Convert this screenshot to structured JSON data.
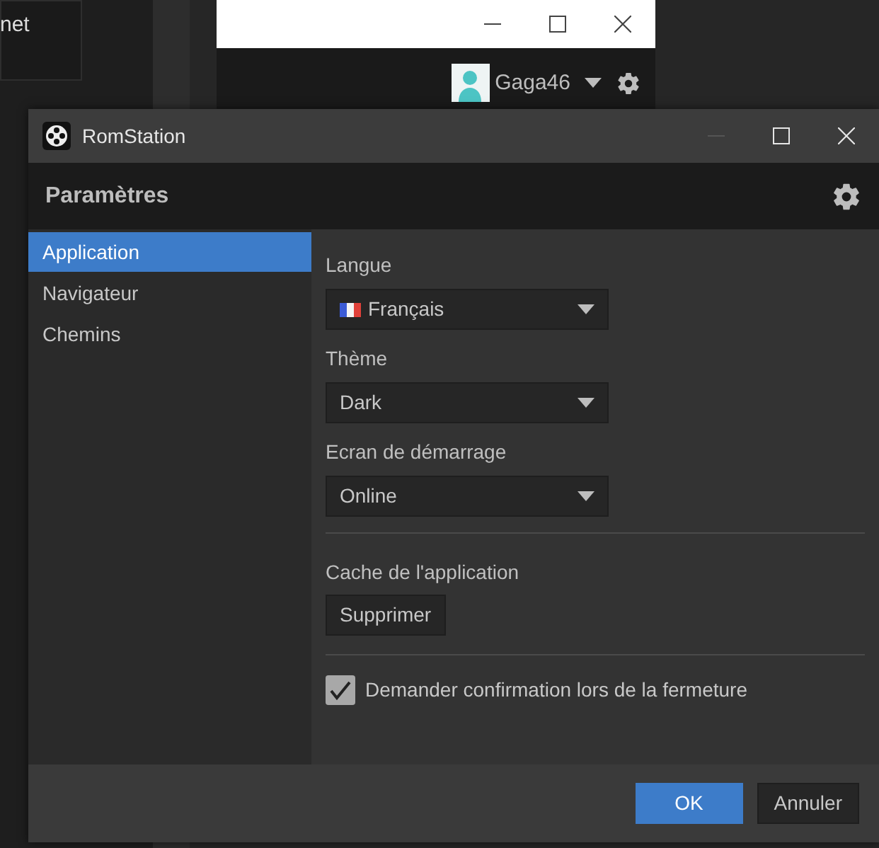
{
  "background_window": {
    "partial_text": "net",
    "user": {
      "name": "Gaga46"
    }
  },
  "window": {
    "title": "RomStation"
  },
  "header": {
    "title": "Paramètres"
  },
  "sidebar": {
    "items": [
      {
        "label": "Application",
        "selected": true
      },
      {
        "label": "Navigateur",
        "selected": false
      },
      {
        "label": "Chemins",
        "selected": false
      }
    ]
  },
  "fields": [
    {
      "label": "Langue",
      "value": "Français",
      "flag": true
    },
    {
      "label": "Thème",
      "value": "Dark"
    },
    {
      "label": "Ecran de démarrage",
      "value": "Online"
    }
  ],
  "cache": {
    "label": "Cache de l'application",
    "button": "Supprimer"
  },
  "confirm": {
    "label": "Demander confirmation lors de la fermeture",
    "checked": true
  },
  "buttons": [
    {
      "label": "OK",
      "primary": true
    },
    {
      "label": "Annuler",
      "primary": false
    }
  ]
}
